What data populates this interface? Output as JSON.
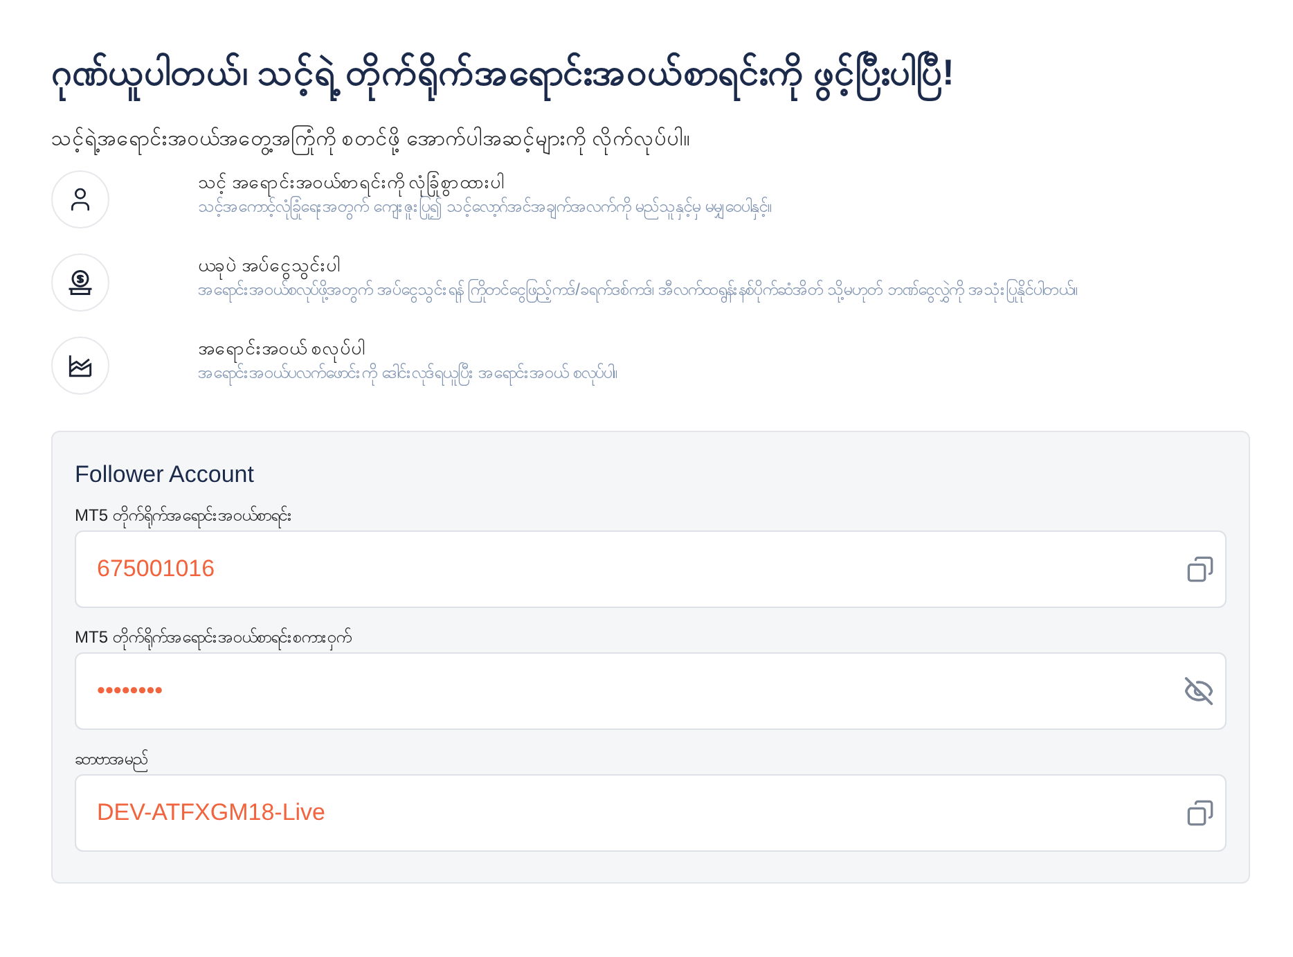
{
  "title": "ဂုဏ်ယူပါတယ်၊ သင့်ရဲ့ တိုက်ရိုက်အရောင်းအဝယ်စာရင်းကို ဖွင့်ပြီးပါပြီ!",
  "subtitle": "သင့်ရဲ့အရောင်းအဝယ်အတွေ့အကြုံကို စတင်ဖို့ အောက်ပါအဆင့်များကို လိုက်လုပ်ပါ။",
  "steps": [
    {
      "kind": "user",
      "title": "သင့် အရောင်းအဝယ်စာရင်းကို လုံခြုံစွာထားပါ",
      "description": "သင့်အကောင့်လုံခြုံရေးအတွက် ကျေးဇူးပြု၍ သင့်လော့ဂ်အင်အချက်အလက်ကို မည်သူနှင့်မှ မမျှဝေပါနှင့်။"
    },
    {
      "kind": "deposit",
      "title": "ယခုပဲ အပ်ငွေသွင်းပါ",
      "description": "အရောင်းအဝယ်စလုပ်ဖို့အတွက် အပ်ငွေသွင်းရန် ကြိုတင်ငွေဖြည့်ကဒ်/ခရက်ဒစ်ကဒ်၊ အီလက်ထရွန်းနစ်ပိုက်ဆံအိတ် သို့မဟုတ် ဘဏ်ငွေလွှဲကို အသုံးပြုနိုင်ပါတယ်။"
    },
    {
      "kind": "chart",
      "title": "အရောင်းအဝယ် စလုပ်ပါ",
      "description": "အရောင်းအဝယ်ပလက်ဖောင်းကို ဒေါင်းလုဒ်ရယူပြီး အရောင်းအဝယ် စလုပ်ပါ။"
    }
  ],
  "account": {
    "title": "Follower Account",
    "fields": [
      {
        "label": "MT5 တိုက်ရိုက်အရောင်းအဝယ်စာရင်း",
        "value": "675001016",
        "kind": "copy"
      },
      {
        "label": "MT5 တိုက်ရိုက်အရောင်းအဝယ်စာရင်းစကားဝှက်",
        "value": "••••••••",
        "kind": "reveal"
      },
      {
        "label": "ဆာဗာအမည်",
        "value": "DEV-ATFXGM18-Live",
        "kind": "copy"
      }
    ]
  }
}
